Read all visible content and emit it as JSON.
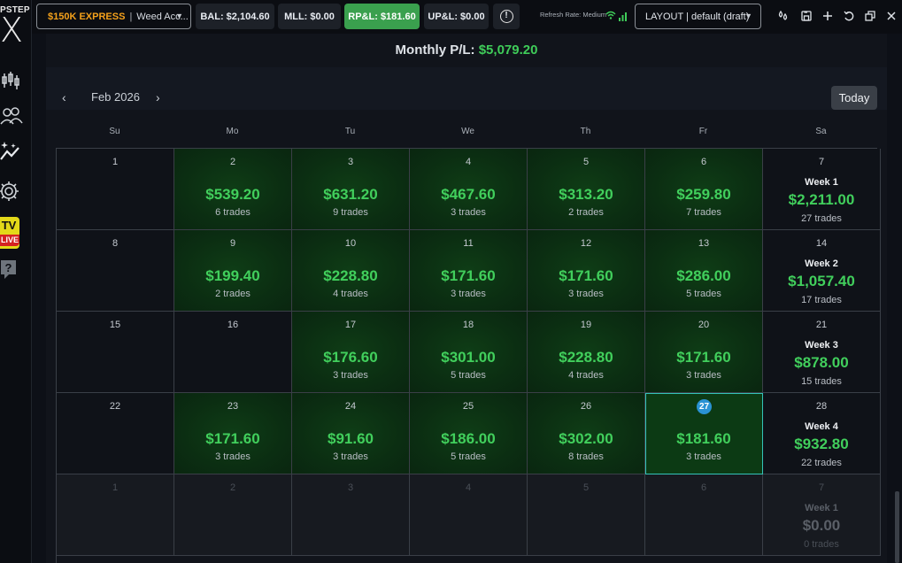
{
  "sidebar": {
    "logo_text": "PSTEP",
    "logo_x": "X",
    "icons": [
      "candlestick-icon",
      "users-icon",
      "trend-sparkle-icon",
      "gear-icon",
      "tv-live-icon",
      "help-icon"
    ],
    "tv_label": "TV",
    "live_label": "LIVE"
  },
  "topbar": {
    "account_plan": "$150K EXPRESS",
    "account_sep": "|",
    "account_name": "Weed Acc...",
    "bal": "BAL: $2,104.60",
    "mll": "MLL: $0.00",
    "rpl": "RP&L: $181.60",
    "upl": "UP&L: $0.00",
    "refresh": "Refresh Rate: Medium",
    "layout": "LAYOUT | default (draft)"
  },
  "summary": {
    "label": "Monthly P/L:",
    "value": "$5,079.20"
  },
  "calendar": {
    "month": "Feb 2026",
    "today_button": "Today",
    "weekdays": [
      "Su",
      "Mo",
      "Tu",
      "We",
      "Th",
      "Fr",
      "Sa"
    ]
  },
  "weeks": [
    [
      {
        "d": "1"
      },
      {
        "d": "2",
        "amt": "$539.20",
        "t": "6 trades"
      },
      {
        "d": "3",
        "amt": "$631.20",
        "t": "9 trades"
      },
      {
        "d": "4",
        "amt": "$467.60",
        "t": "3 trades"
      },
      {
        "d": "5",
        "amt": "$313.20",
        "t": "2 trades"
      },
      {
        "d": "6",
        "amt": "$259.80",
        "t": "7 trades"
      },
      {
        "d": "7",
        "wk": "Week 1",
        "amt": "$2,211.00",
        "t": "27 trades"
      }
    ],
    [
      {
        "d": "8"
      },
      {
        "d": "9",
        "amt": "$199.40",
        "t": "2 trades"
      },
      {
        "d": "10",
        "amt": "$228.80",
        "t": "4 trades"
      },
      {
        "d": "11",
        "amt": "$171.60",
        "t": "3 trades"
      },
      {
        "d": "12",
        "amt": "$171.60",
        "t": "3 trades"
      },
      {
        "d": "13",
        "amt": "$286.00",
        "t": "5 trades"
      },
      {
        "d": "14",
        "wk": "Week 2",
        "amt": "$1,057.40",
        "t": "17 trades"
      }
    ],
    [
      {
        "d": "15"
      },
      {
        "d": "16"
      },
      {
        "d": "17",
        "amt": "$176.60",
        "t": "3 trades"
      },
      {
        "d": "18",
        "amt": "$301.00",
        "t": "5 trades"
      },
      {
        "d": "19",
        "amt": "$228.80",
        "t": "4 trades"
      },
      {
        "d": "20",
        "amt": "$171.60",
        "t": "3 trades"
      },
      {
        "d": "21",
        "wk": "Week 3",
        "amt": "$878.00",
        "t": "15 trades"
      }
    ],
    [
      {
        "d": "22"
      },
      {
        "d": "23",
        "amt": "$171.60",
        "t": "3 trades"
      },
      {
        "d": "24",
        "amt": "$91.60",
        "t": "3 trades"
      },
      {
        "d": "25",
        "amt": "$186.00",
        "t": "5 trades"
      },
      {
        "d": "26",
        "amt": "$302.00",
        "t": "8 trades"
      },
      {
        "d": "27",
        "amt": "$181.60",
        "t": "3 trades",
        "today": true
      },
      {
        "d": "28",
        "wk": "Week 4",
        "amt": "$932.80",
        "t": "22 trades"
      }
    ],
    [
      {
        "d": "1",
        "dim": true
      },
      {
        "d": "2",
        "dim": true
      },
      {
        "d": "3",
        "dim": true
      },
      {
        "d": "4",
        "dim": true
      },
      {
        "d": "5",
        "dim": true
      },
      {
        "d": "6",
        "dim": true
      },
      {
        "d": "7",
        "dim": true,
        "wk": "Week 1",
        "amt": "$0.00",
        "t": "0 trades"
      }
    ]
  ],
  "colors": {
    "profit_green": "#41cf5c",
    "rpl_bg": "#3aa04e",
    "account_gold": "#f4a11b",
    "today_ring": "#34c2b8"
  }
}
